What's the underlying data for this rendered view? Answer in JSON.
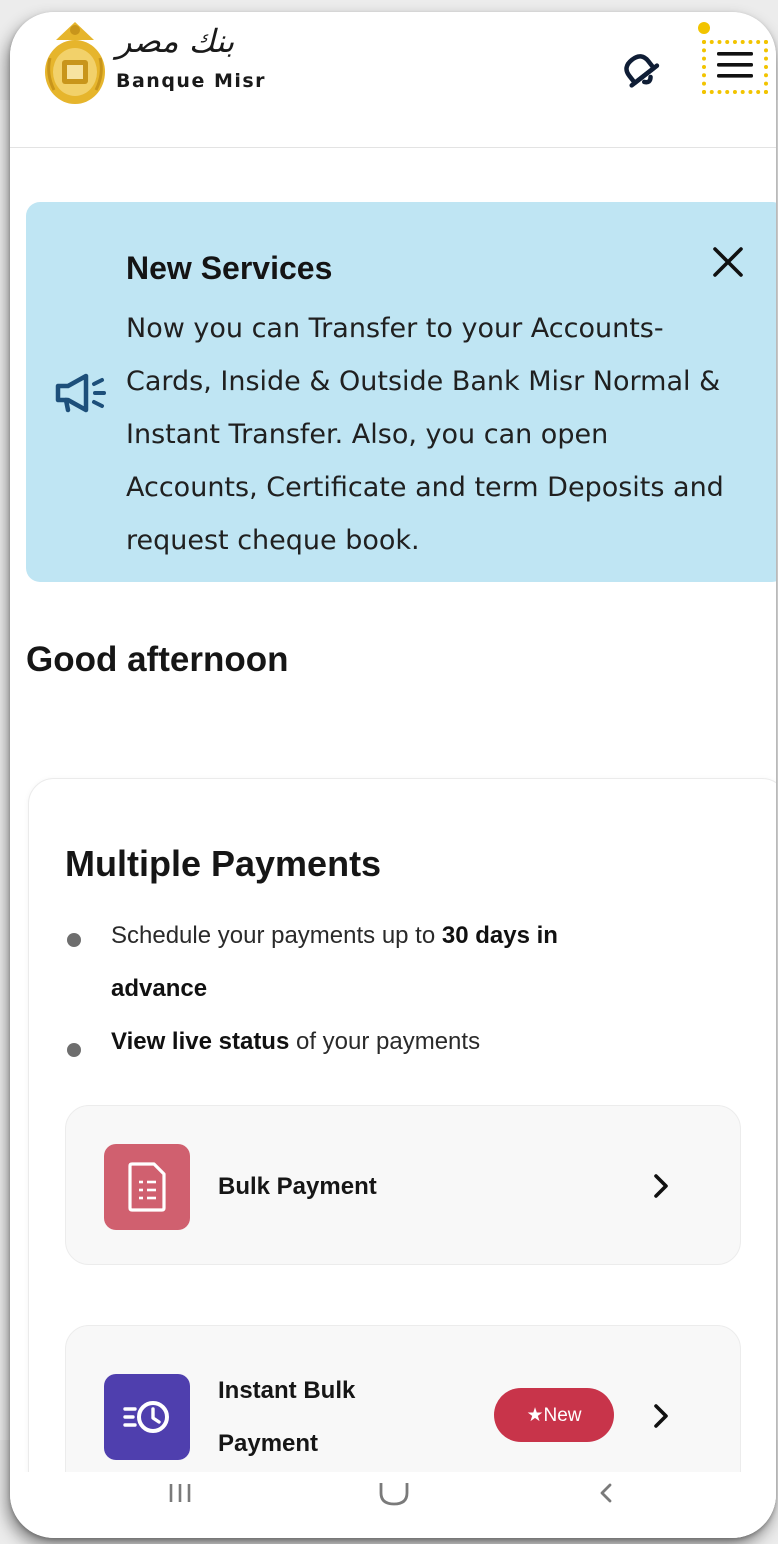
{
  "header": {
    "logo_arabic": "بنك مصر",
    "logo_latin": "Banque Misr",
    "bell_icon": "bell-icon",
    "menu_icon": "hamburger-menu-icon"
  },
  "banner": {
    "icon": "megaphone-icon",
    "title": "New Services",
    "text": "Now you can Transfer to your Accounts-Cards, Inside & Outside Bank Misr Normal & Instant Transfer. Also, you can open Accounts, Certificate and term Deposits and request cheque book.",
    "close_icon": "close-icon"
  },
  "greeting": "Good afternoon",
  "payments": {
    "title": "Multiple Payments",
    "bullets": [
      {
        "pre": "Schedule your payments up to ",
        "bold": "30 days in advance",
        "post": ""
      },
      {
        "pre": "",
        "bold": "View live status",
        "post": " of your payments"
      }
    ],
    "options": [
      {
        "label": "Bulk Payment",
        "icon": "document-icon",
        "icon_color": "#d0606f",
        "badge": ""
      },
      {
        "label": "Instant Bulk Payment",
        "icon": "fast-clock-icon",
        "icon_color": "#4f3fae",
        "badge": "★New"
      }
    ]
  },
  "navbar": {
    "icons": [
      "recent-apps-icon",
      "home-icon",
      "back-icon"
    ]
  },
  "colors": {
    "banner_bg": "#bfe5f3",
    "badge_bg": "#c8344a",
    "highlight": "#f2c400"
  }
}
